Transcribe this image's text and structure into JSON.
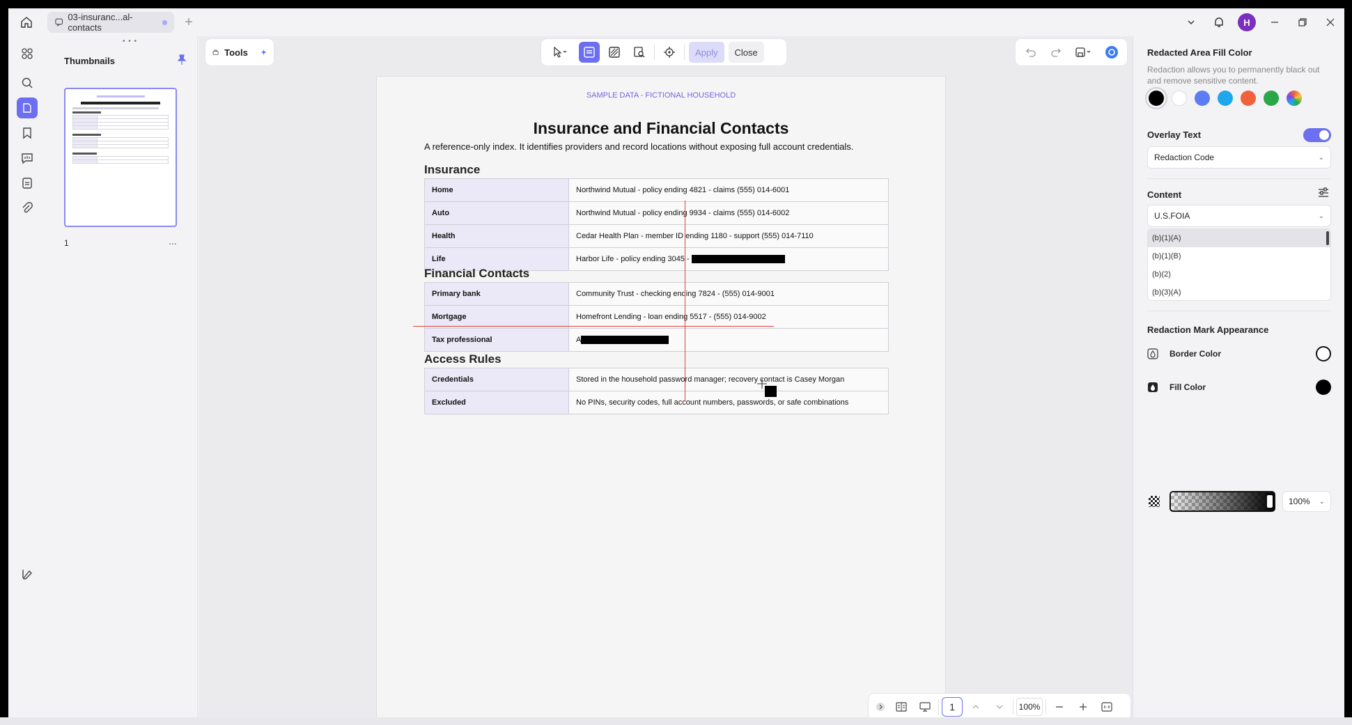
{
  "tab": {
    "title": "03-insuranc...al-contacts"
  },
  "user": {
    "initial": "H"
  },
  "thumbnails": {
    "title": "Thumbnails",
    "page_number": "1",
    "more": "..."
  },
  "toolbar": {
    "tools_label": "Tools",
    "apply_label": "Apply",
    "close_label": "Close"
  },
  "document": {
    "banner": "SAMPLE DATA - FICTIONAL HOUSEHOLD",
    "title": "Insurance and Financial Contacts",
    "intro": "A reference-only index. It identifies providers and record locations without exposing full account credentials.",
    "sections": [
      {
        "heading": "Insurance",
        "rows": [
          {
            "label": "Home",
            "value": "Northwind Mutual - policy ending 4821 - claims (555) 014-6001"
          },
          {
            "label": "Auto",
            "value": "Northwind Mutual - policy ending 9934 - claims (555) 014-6002"
          },
          {
            "label": "Health",
            "value": "Cedar Health Plan - member ID ending 1180 - support (555) 014-7110"
          },
          {
            "label": "Life",
            "value": "Harbor Life - policy ending 3045 - "
          }
        ]
      },
      {
        "heading": "Financial Contacts",
        "rows": [
          {
            "label": "Primary bank",
            "value": "Community Trust - checking ending 7824 - (555) 014-9001"
          },
          {
            "label": "Mortgage",
            "value": "Homefront Lending - loan ending 5517 - (555) 014-9002"
          },
          {
            "label": "Tax professional",
            "value": "A"
          }
        ]
      },
      {
        "heading": "Access Rules",
        "rows": [
          {
            "label": "Credentials",
            "value": "Stored in the household password manager; recovery contact is Casey Morgan"
          },
          {
            "label": "Excluded",
            "value": "No PINs, security codes, full account numbers, passwords, or safe combinations"
          }
        ]
      }
    ]
  },
  "bottom_bar": {
    "page": "1",
    "zoom": "100%"
  },
  "right_panel": {
    "fill_color_title": "Redacted Area Fill Color",
    "description": "Redaction allows you to permanently black out and remove sensitive content.",
    "swatches": [
      "#000000",
      "#ffffff",
      "#5b7cf5",
      "#1ea7ea",
      "#f1613b",
      "#2aa848",
      "multicolor"
    ],
    "overlay_text_label": "Overlay Text",
    "overlay_text_enabled": true,
    "overlay_select": "Redaction Code",
    "content_label": "Content",
    "content_select": "U.S.FOIA",
    "codes": [
      "(b)(1)(A)",
      "(b)(1)(B)",
      "(b)(2)",
      "(b)(3)(A)"
    ],
    "appearance_title": "Redaction Mark Appearance",
    "border_color_label": "Border Color",
    "border_color": "#ffffff",
    "fill_color_label": "Fill Color",
    "fill_color": "#000000",
    "opacity": "100%"
  }
}
